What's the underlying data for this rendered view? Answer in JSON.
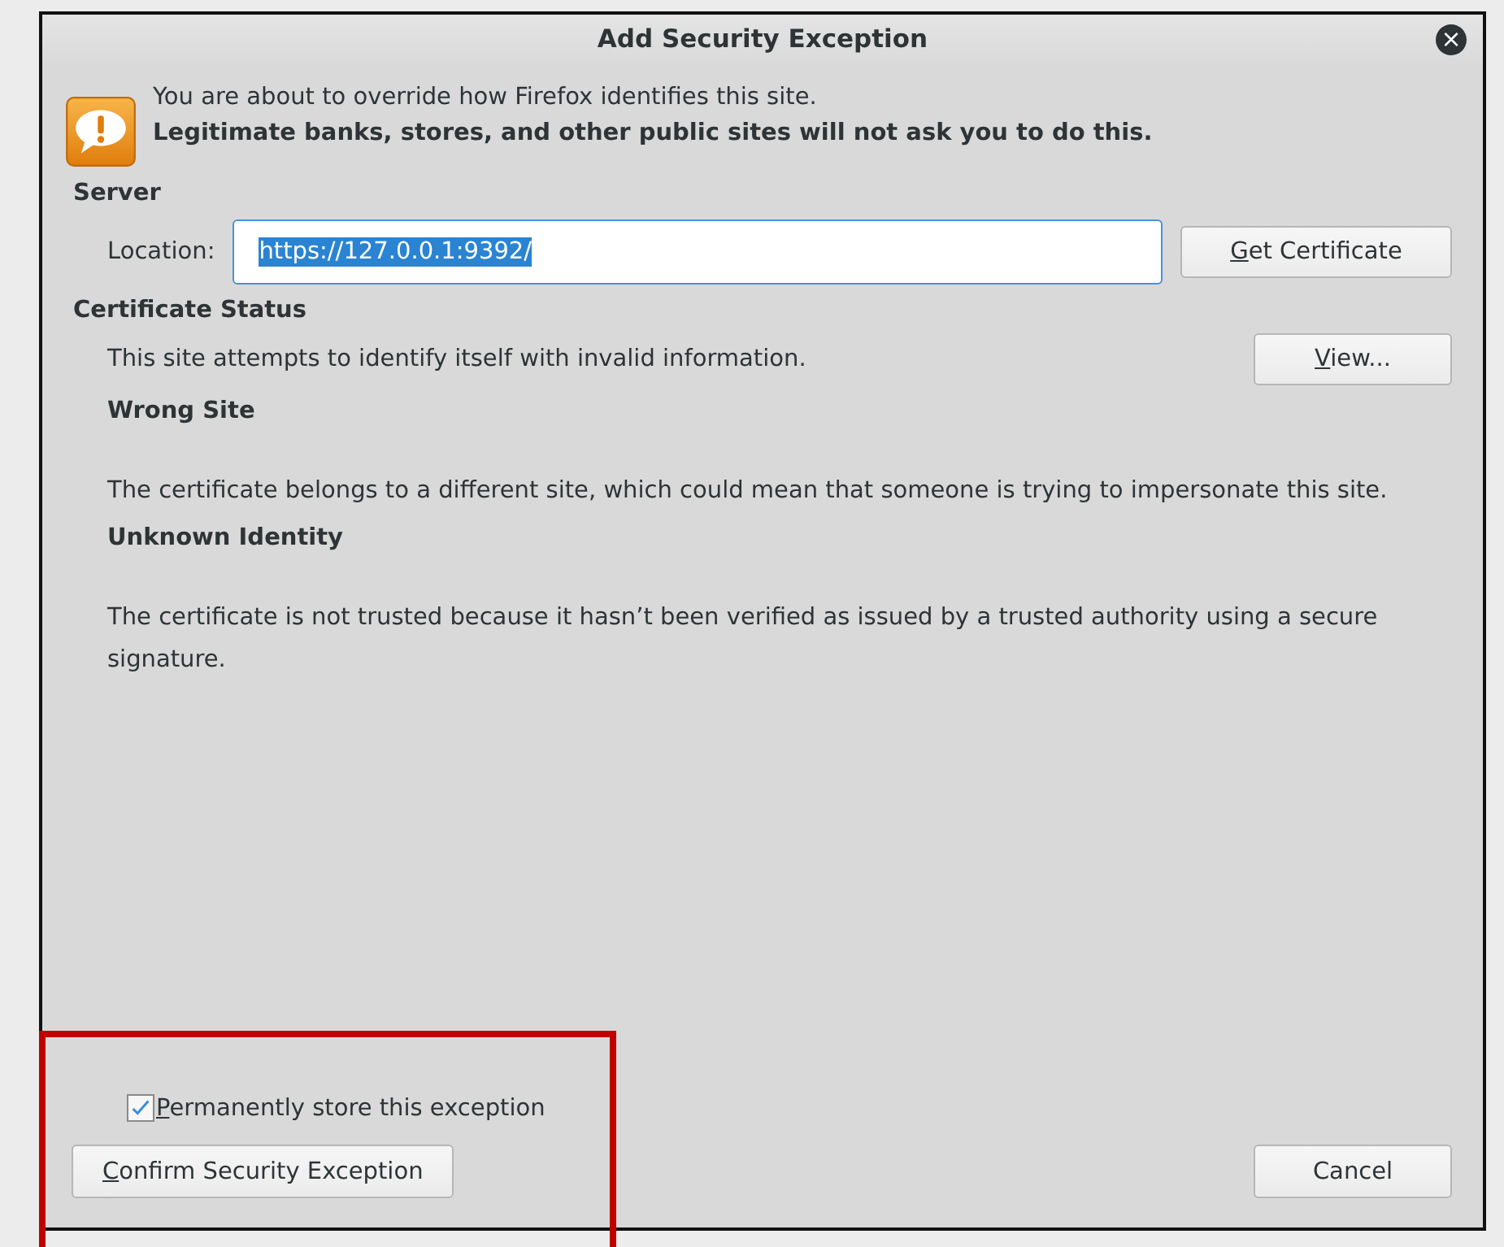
{
  "window": {
    "title": "Add Security Exception",
    "close_button": "×"
  },
  "warning": {
    "line_1": "You are about to override how Firefox identifies this site.",
    "line_2": "Legitimate banks, stores, and other public sites will not ask you to do this."
  },
  "server": {
    "heading": "Server",
    "location_label": "Location:",
    "location_value": "https://127.0.0.1:9392/",
    "value_selected": true,
    "get_certificate_button": {
      "label": "Get Certificate",
      "mnemonic_underlined": true
    }
  },
  "certificate_status": {
    "heading": "Certificate Status",
    "summary": "This site attempts to identify itself with invalid information.",
    "view_button": {
      "label": "View...",
      "mnemonic_underlined": true
    },
    "problems": [
      {
        "title": "Wrong Site",
        "description": "The certificate belongs to a different site, which could mean that someone is trying to impersonate this site."
      },
      {
        "title": "Unknown Identity",
        "description": "The certificate is not trusted because it hasn’t been verified as issued by a trusted authority using a secure signature."
      }
    ]
  },
  "permanent_checkbox": {
    "label": "Permanently store this exception",
    "checked": true,
    "mnemonic_underlined": true
  },
  "buttons": [
    {
      "label": "Confirm Security Exception",
      "mnemonic_underlined": true
    },
    {
      "label": "Cancel",
      "mnemonic_underlined": false
    }
  ],
  "annotation_frame": true
}
